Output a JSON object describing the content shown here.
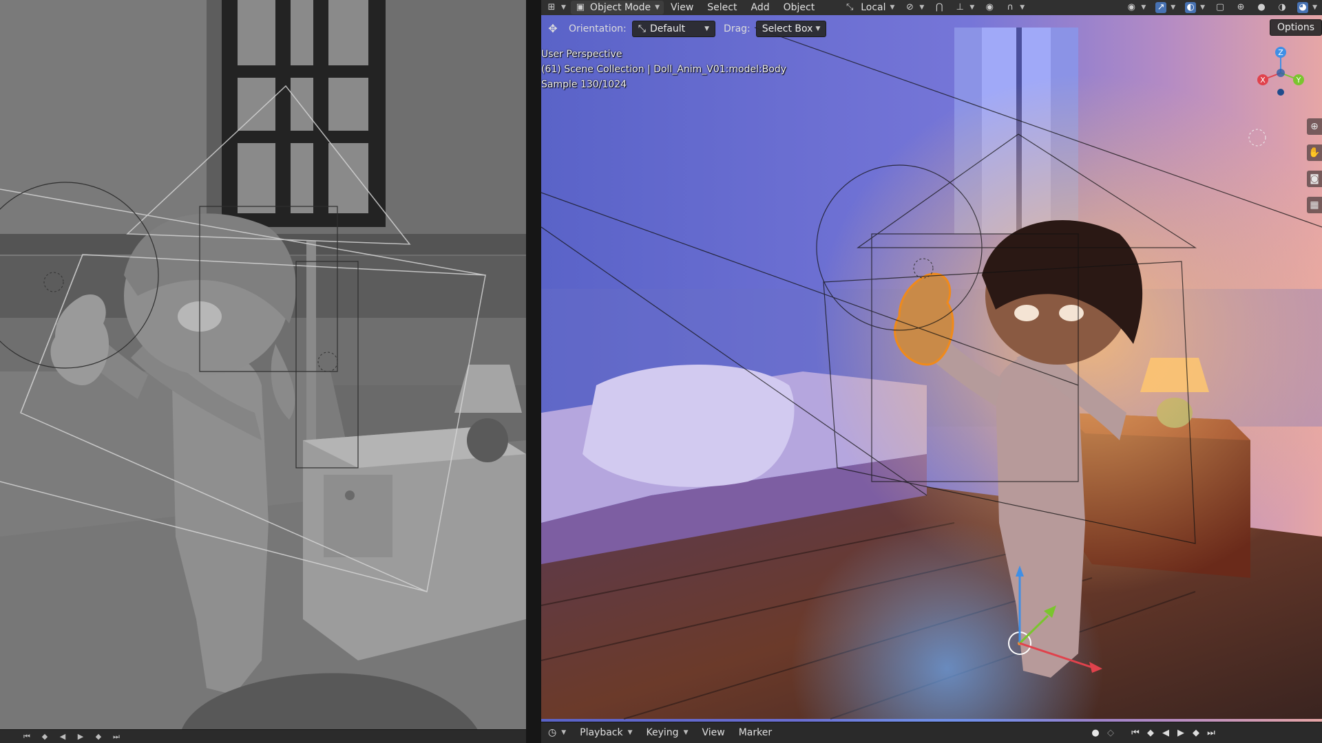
{
  "header": {
    "mode": "Object Mode",
    "menus": [
      "View",
      "Select",
      "Add",
      "Object"
    ],
    "transform_space": "Local"
  },
  "toolheader": {
    "orientation_label": "Orientation:",
    "orientation_value": "Default",
    "drag_label": "Drag:",
    "drag_value": "Select Box",
    "options_label": "Options"
  },
  "viewport_info": {
    "line1": "User Perspective",
    "line2": "(61) Scene Collection | Doll_Anim_V01:model:Body",
    "line3": "Sample 130/1024"
  },
  "gizmo": {
    "x_label": "X",
    "y_label": "Y",
    "z_label": "Z"
  },
  "timeline": {
    "menus": [
      "Playback",
      "Keying",
      "View",
      "Marker"
    ]
  },
  "colors": {
    "header_bg": "#303030",
    "accent_blue": "#4772b3",
    "axis_x": "#e0424c",
    "axis_y": "#7ac52e",
    "axis_z": "#3f8fe6",
    "selection_orange": "#f08a1a"
  }
}
